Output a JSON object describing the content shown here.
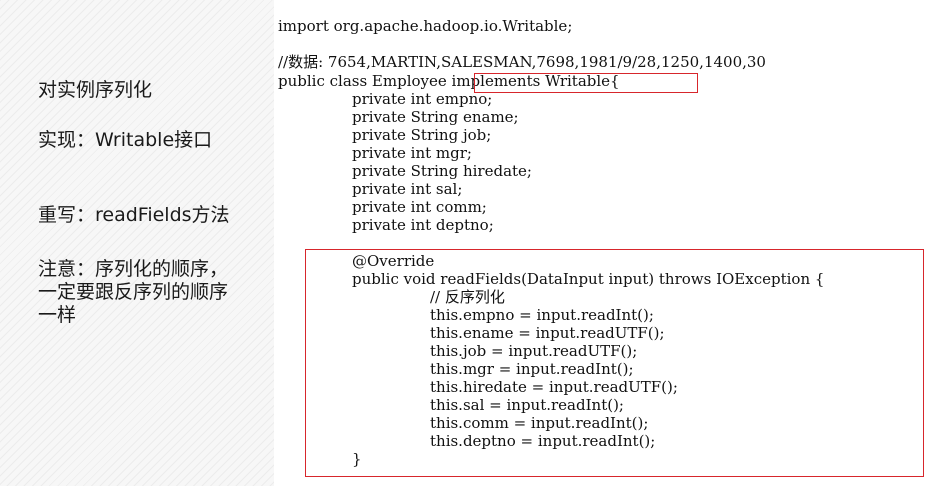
{
  "notes": {
    "serialize": "对实例序列化",
    "implement": "实现：Writable接口",
    "override": "重写：readFields方法",
    "caution": "注意：序列化的顺序，\n一定要跟反序列的顺序\n一样"
  },
  "code": {
    "import": "import org.apache.hadoop.io.Writable;",
    "data_comment": "//数据: 7654,MARTIN,SALESMAN,7698,1981/9/28,1250,1400,30",
    "class_decl_start": "public class Employee",
    "class_decl_impl": " implements Writable{",
    "fields": [
      "private int empno;",
      "private String ename;",
      "private String job;",
      "private int mgr;",
      "private String hiredate;",
      "private int sal;",
      "private int comm;",
      "private int deptno;"
    ],
    "annotation": "@Override",
    "method_signature": "public void readFields(DataInput input) throws IOException {",
    "method_comment": "// 反序列化",
    "method_body": [
      "this.empno = input.readInt();",
      "this.ename = input.readUTF();",
      "this.job = input.readUTF();",
      "this.mgr = input.readInt();",
      "this.hiredate = input.readUTF();",
      "this.sal = input.readInt();",
      "this.comm = input.readInt();",
      "this.deptno = input.readInt();"
    ],
    "method_close": "}"
  },
  "colors": {
    "highlight_border": "#d7262c",
    "text": "#111111"
  }
}
